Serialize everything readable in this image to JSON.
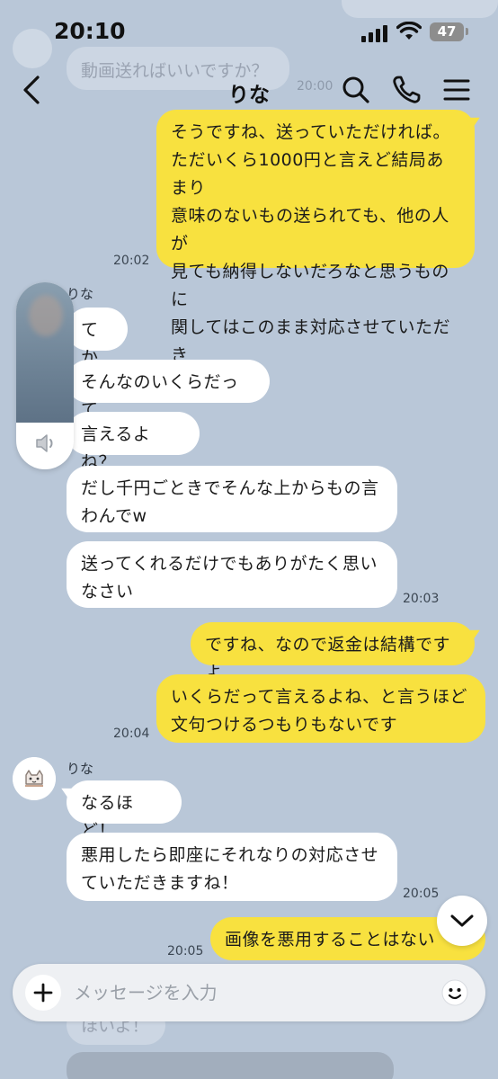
{
  "status_bar": {
    "time": "20:10",
    "battery": "47"
  },
  "header": {
    "title": "りな"
  },
  "ghost": {
    "top_message": "動画送ればいいですか？",
    "top_time": "20:00",
    "bottom_message": "ほいよ！"
  },
  "messages": {
    "m1": {
      "text": "そうですね、送っていただければ。ただいくら1000円と言えど結局あまり\n意味のないもの送られても、他の人が\n見ても納得しないだろなと思うものに\n関してはこのまま対応させていただき\nます",
      "time": "20:02"
    },
    "sender1": "りな",
    "m2": {
      "text": "てか"
    },
    "m3": {
      "text": "そんなのいくらだって"
    },
    "m4": {
      "text": "言えるよね？"
    },
    "m5": {
      "text": "だし千円ごときでそんな上からもの言\nわんでw"
    },
    "m6": {
      "text": "送ってくれるだけでもありがたく思い\nなさい",
      "time": "20:03"
    },
    "m7": {
      "text": "ですね、なので返金は結構ですよ"
    },
    "m8": {
      "text": "いくらだって言えるよね、と言うほど\n文句つけるつもりもないです",
      "time": "20:04"
    },
    "sender2": "りな",
    "m9": {
      "text": "なるほど！"
    },
    "m10": {
      "text": "悪用したら即座にそれなりの対応させ\nていただきますね！",
      "time": "20:05"
    },
    "m11": {
      "text": "画像を悪用することはない",
      "time": "20:05"
    }
  },
  "input": {
    "placeholder": "メッセージを入力"
  },
  "colors": {
    "background": "#b9c7d8",
    "my_bubble": "#f8e13f",
    "their_bubble": "#ffffff"
  }
}
